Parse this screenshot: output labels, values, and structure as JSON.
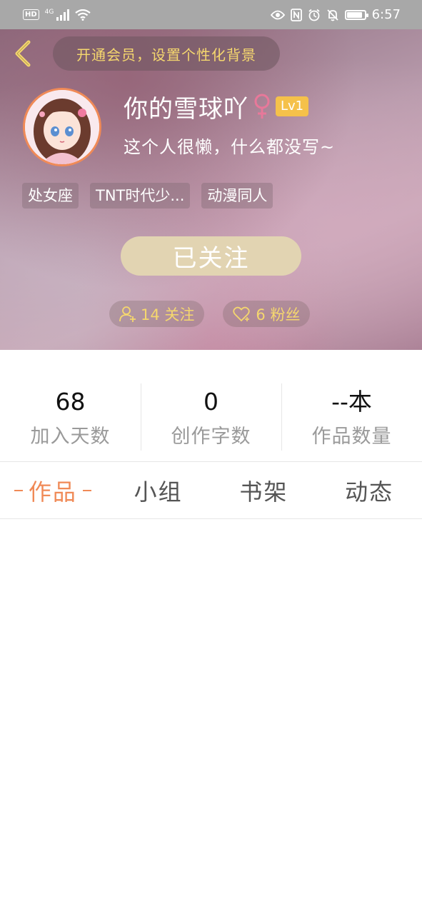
{
  "status_bar": {
    "hd_label": "HD",
    "network": "4G",
    "battery_level": 0.9,
    "time": "6:57"
  },
  "header": {
    "vip_banner": "开通会员，设置个性化背景",
    "nickname": "你的雪球吖",
    "gender_symbol": "♀",
    "level": "Lv1",
    "bio": "这个人很懒，什么都没写~",
    "tags": [
      "处女座",
      "TNT时代少...",
      "动漫同人"
    ],
    "follow_button": "已关注",
    "following": "14 关注",
    "followers": "6 粉丝"
  },
  "stats": [
    {
      "value": "68",
      "label": "加入天数"
    },
    {
      "value": "0",
      "label": "创作字数"
    },
    {
      "value": "--本",
      "label": "作品数量"
    }
  ],
  "tabs": [
    {
      "label": "作品",
      "active": true
    },
    {
      "label": "小组",
      "active": false
    },
    {
      "label": "书架",
      "active": false
    },
    {
      "label": "动态",
      "active": false
    }
  ],
  "colors": {
    "accent": "#f08a57",
    "gold": "#f5d76e",
    "level_badge": "#f5c14a",
    "follow_button": "#e2d4b2"
  }
}
